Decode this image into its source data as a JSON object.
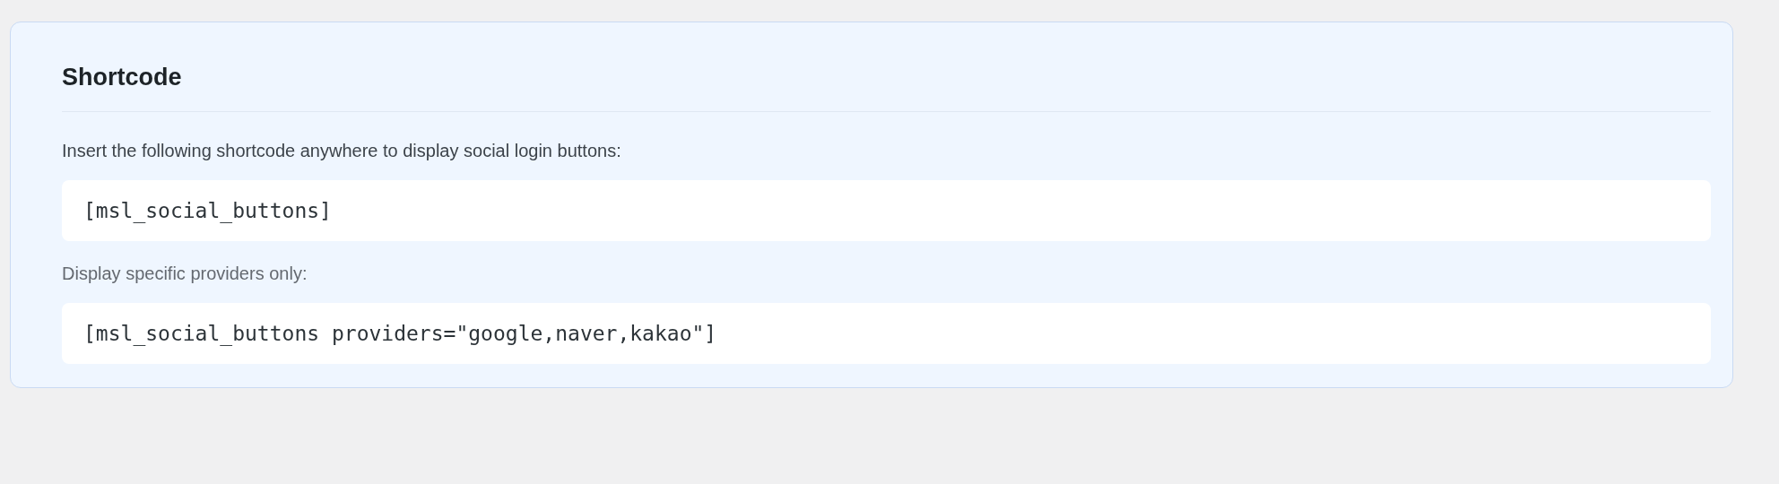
{
  "section": {
    "title": "Shortcode",
    "intro": "Insert the following shortcode anywhere to display social login buttons:",
    "shortcode": "[msl_social_buttons]",
    "note": "Display specific providers only:",
    "example": "[msl_social_buttons providers=\"google,naver,kakao\"]"
  }
}
